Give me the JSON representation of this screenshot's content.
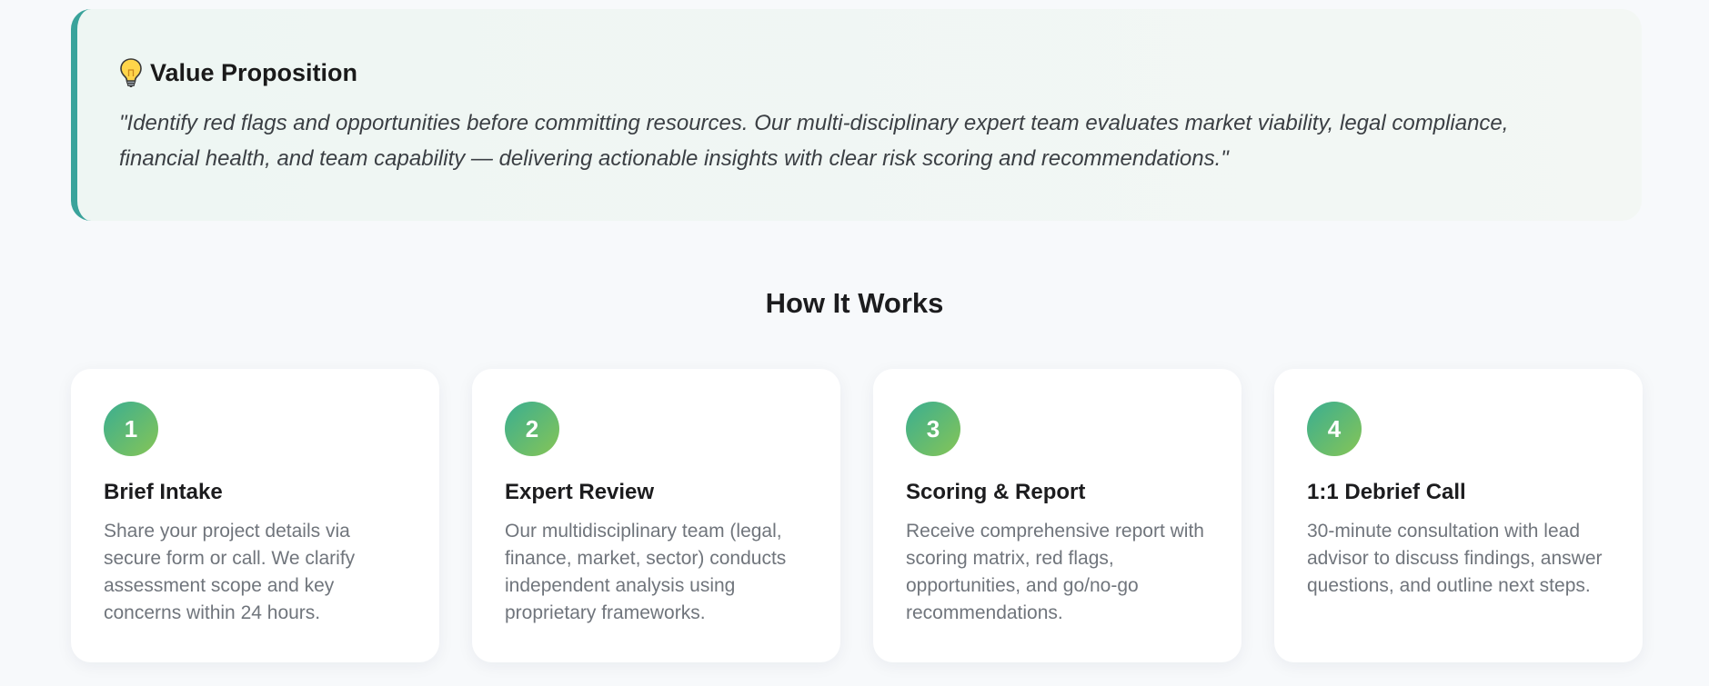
{
  "value_proposition": {
    "title": "Value Proposition",
    "icon": "lightbulb-icon",
    "quote": "\"Identify red flags and opportunities before committing resources. Our multi-disciplinary expert team evaluates market viability, legal compliance, financial health, and team capability — delivering actionable insights with clear risk scoring and recommendations.\"",
    "accent_color": "#3aa39b"
  },
  "how_it_works": {
    "heading": "How It Works",
    "steps": [
      {
        "number": "1",
        "title": "Brief Intake",
        "description": "Share your project details via secure form or call. We clarify assessment scope and key concerns within 24 hours."
      },
      {
        "number": "2",
        "title": "Expert Review",
        "description": "Our multidisciplinary team (legal, finance, market, sector) conducts independent analysis using proprietary frameworks."
      },
      {
        "number": "3",
        "title": "Scoring & Report",
        "description": "Receive comprehensive report with scoring matrix, red flags, opportunities, and go/no-go recommendations."
      },
      {
        "number": "4",
        "title": "1:1 Debrief Call",
        "description": "30-minute consultation with lead advisor to discuss findings, answer questions, and outline next steps."
      }
    ],
    "badge_gradient": [
      "#3aae91",
      "#86c556"
    ]
  }
}
